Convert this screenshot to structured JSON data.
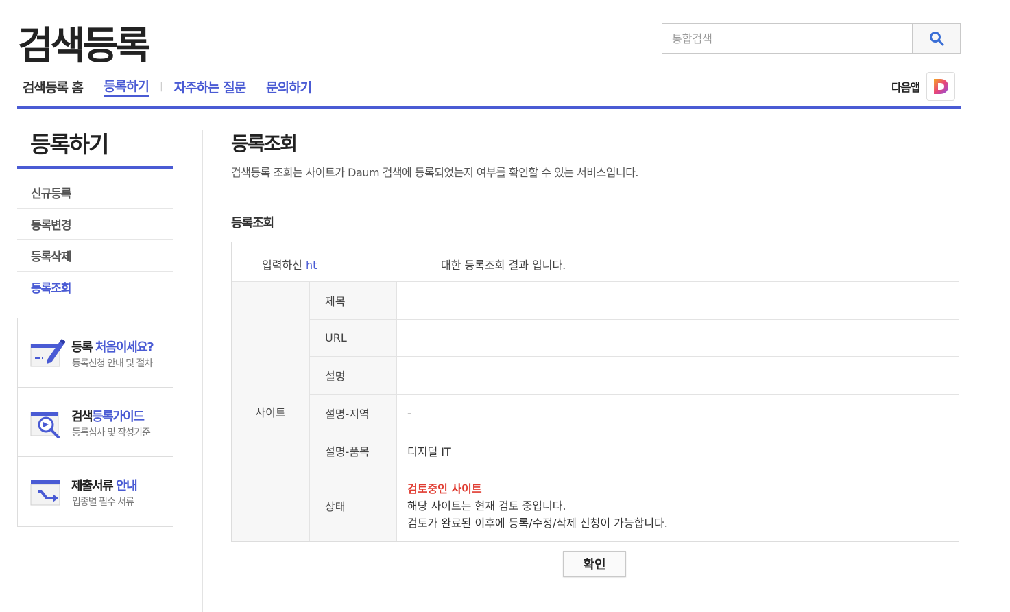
{
  "header": {
    "logo": "검색등록",
    "search_placeholder": "통합검색",
    "nav": {
      "home": "검색등록 홈",
      "register": "등록하기",
      "separator": "|",
      "faq": "자주하는 질문",
      "inquiry": "문의하기"
    },
    "daum_app_label": "다음앱",
    "accent_color": "#4a5bd4"
  },
  "sidebar": {
    "title": "등록하기",
    "menu": [
      {
        "label": "신규등록"
      },
      {
        "label": "등록변경"
      },
      {
        "label": "등록삭제"
      },
      {
        "label": "등록조회",
        "active": true
      }
    ],
    "banners": [
      {
        "title_pre": "등록 ",
        "title_hl": "처음이세요?",
        "title_post": "",
        "sub": "등록신청 안내 및 절차",
        "icon": "pencil-document-icon"
      },
      {
        "title_pre": "검색",
        "title_hl": "등록가이드",
        "title_post": "",
        "sub": "등록심사 및 작성기준",
        "icon": "magnifier-guide-icon"
      },
      {
        "title_pre": "제출서류 ",
        "title_hl": "안내",
        "title_post": "",
        "sub": "업종별 필수 서류",
        "icon": "document-arrow-icon"
      }
    ]
  },
  "main": {
    "title": "등록조회",
    "description": "검색등록 조회는 사이트가 Daum 검색에 등록되었는지 여부를 확인할 수 있는 서비스입니다.",
    "section_title": "등록조회",
    "result": {
      "intro_pre": "입력하신 ",
      "intro_url": "ht",
      "intro_post": "대한 등록조회 결과 입니다.",
      "group_label": "사이트",
      "rows": [
        {
          "label": "제목",
          "value": ""
        },
        {
          "label": "URL",
          "value": ""
        },
        {
          "label": "설명",
          "value": ""
        },
        {
          "label": "설명-지역",
          "value": "-"
        },
        {
          "label": "설명-품목",
          "value": "디지털 IT"
        },
        {
          "label": "상태",
          "status": "검토중인 사이트",
          "lines": [
            "해당 사이트는 현재 검토 중입니다.",
            "검토가 완료된 이후에 등록/수정/삭제 신청이 가능합니다."
          ]
        }
      ],
      "status_color": "#e03c31"
    },
    "confirm_label": "확인"
  }
}
